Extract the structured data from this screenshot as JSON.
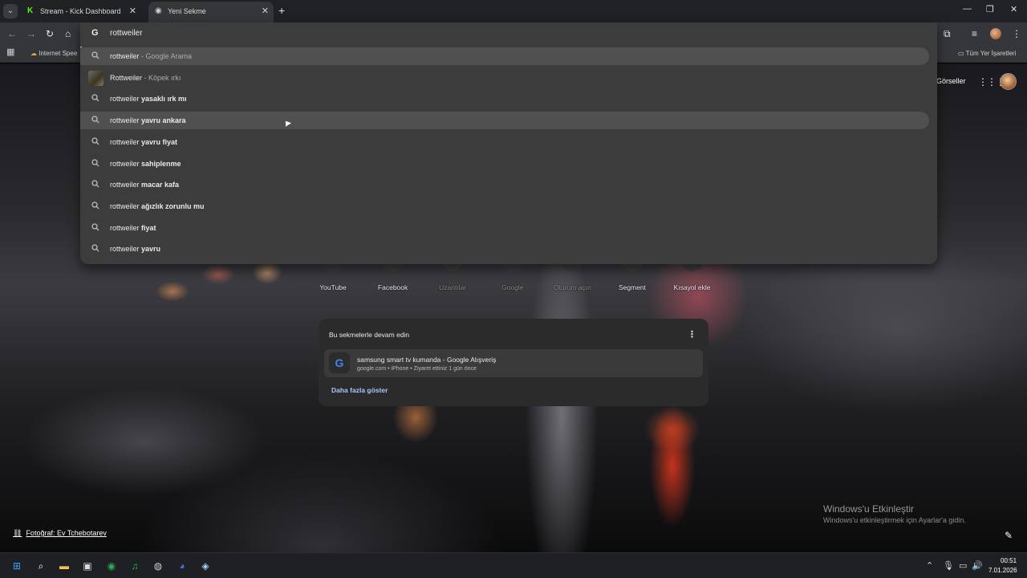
{
  "tabs": [
    {
      "label": "Stream - Kick Dashboard",
      "icon": "kick-icon",
      "icon_glyph": "K",
      "active": false
    },
    {
      "label": "Yeni Sekme",
      "icon": "chrome-icon",
      "icon_glyph": "◉",
      "active": true
    }
  ],
  "tab_close_glyph": "✕",
  "new_tab_glyph": "+",
  "window_controls": {
    "minimize": "—",
    "restore": "❐",
    "close": "✕"
  },
  "toolbar": {
    "back": "←",
    "forward": "→",
    "reload": "↻",
    "home": "⌂"
  },
  "omnibox": {
    "engine_glyph": "G",
    "value": "rottweiler"
  },
  "bookmarks": {
    "first": "Internet Spee",
    "all_bookmarks": "Tüm Yer İşaretleri",
    "apps_glyph": "▦"
  },
  "suggestions": [
    {
      "prefix": "rottweiler",
      "bold": "",
      "suffix": " - Google Arama",
      "icon": "search-icon",
      "highlighted": true
    },
    {
      "prefix": "Rottweiler",
      "bold": "",
      "suffix": " - Köpek ırkı",
      "icon": "image-thumb",
      "highlighted": false
    },
    {
      "prefix": "rottweiler ",
      "bold": "yasaklı ırk mı",
      "suffix": "",
      "icon": "search-icon",
      "highlighted": false
    },
    {
      "prefix": "rottweiler ",
      "bold": "yavru ankara",
      "suffix": "",
      "icon": "search-icon",
      "highlighted": true
    },
    {
      "prefix": "rottweiler ",
      "bold": "yavru fiyat",
      "suffix": "",
      "icon": "search-icon",
      "highlighted": false
    },
    {
      "prefix": "rottweiler ",
      "bold": "sahiplenme",
      "suffix": "",
      "icon": "search-icon",
      "highlighted": false
    },
    {
      "prefix": "rottweiler ",
      "bold": "macar kafa",
      "suffix": "",
      "icon": "search-icon",
      "highlighted": false
    },
    {
      "prefix": "rottweiler ",
      "bold": "ağızlık zorunlu mu",
      "suffix": "",
      "icon": "search-icon",
      "highlighted": false
    },
    {
      "prefix": "rottweiler ",
      "bold": "fiyat",
      "suffix": "",
      "icon": "search-icon",
      "highlighted": false
    },
    {
      "prefix": "rottweiler ",
      "bold": "yavru",
      "suffix": "",
      "icon": "search-icon",
      "highlighted": false
    }
  ],
  "ntp": {
    "images_link": "Görseller",
    "shortcuts": [
      {
        "label": "YouTube",
        "dim": false,
        "color": "#c4302b"
      },
      {
        "label": "Facebook",
        "dim": false,
        "color": "#1877f2"
      },
      {
        "label": "Uzantılar",
        "dim": true,
        "color": "#3b5bdb"
      },
      {
        "label": "Google",
        "dim": true,
        "color": "#34a853"
      },
      {
        "label": "Oturum açın",
        "dim": true,
        "color": "#2e7d32"
      },
      {
        "label": "Segment",
        "dim": false,
        "color": "#8d8d3f"
      },
      {
        "label": "Kısayol ekle",
        "dim": false,
        "color": "#3c3c3c"
      }
    ],
    "continue_card": {
      "title": "Bu sekmelerle devam edin",
      "item_title": "samsung smart tv kumanda - Google Alışveriş",
      "item_sub": "google.com • iPhone • Ziyaret ettiniz 1 gün önce",
      "item_icon_glyph": "G",
      "show_more": "Daha fazla göster"
    },
    "photo_credit": "Fotoğraf: Ev Tchebotarev",
    "watermark_title": "Windows'u Etkinleştir",
    "watermark_sub": "Windows'u etkinleştirmek için Ayarlar'a gidin."
  },
  "taskbar": {
    "apps": [
      {
        "name": "windows-start-icon",
        "glyph": "⊞",
        "color": "#3aa0ff"
      },
      {
        "name": "search-icon",
        "glyph": "⌕",
        "color": "#ffffff"
      },
      {
        "name": "file-explorer-icon",
        "glyph": "▬",
        "color": "#f2c14e"
      },
      {
        "name": "microsoft-store-icon",
        "glyph": "▣",
        "color": "#dddddd"
      },
      {
        "name": "chrome-icon",
        "glyph": "◉",
        "color": "#34a853"
      },
      {
        "name": "spotify-icon",
        "glyph": "♫",
        "color": "#1db954"
      },
      {
        "name": "app-icon",
        "glyph": "◍",
        "color": "#cccccc"
      },
      {
        "name": "discord-icon",
        "glyph": "◕",
        "color": "#5865f2"
      },
      {
        "name": "steam-icon",
        "glyph": "◈",
        "color": "#9fd3ff"
      }
    ],
    "time": "00:51",
    "date": "7.01.2026"
  }
}
